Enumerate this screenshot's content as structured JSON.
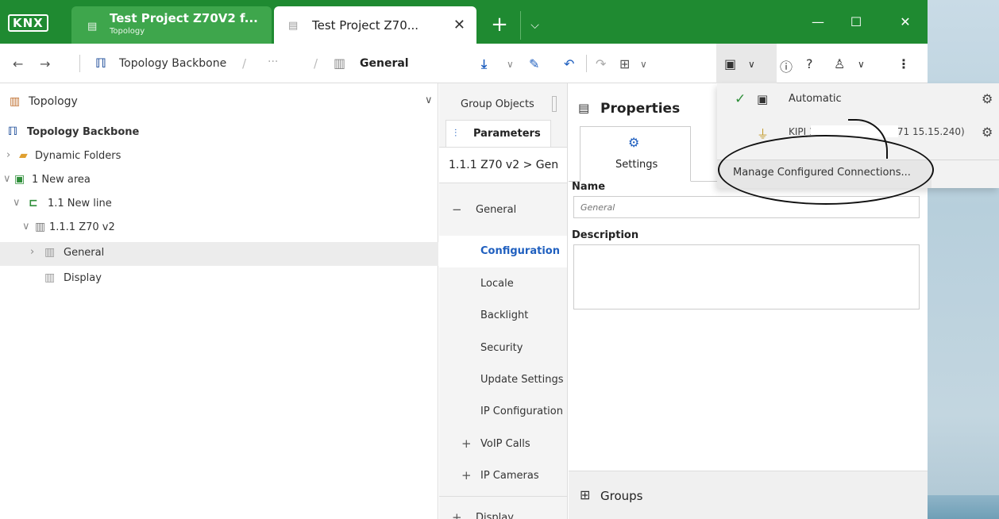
{
  "app": {
    "tabs": [
      {
        "title": "Test Project Z70V2 f...",
        "subtitle": "Topology"
      },
      {
        "title": "Test Project Z70..."
      }
    ],
    "logo_text": "KNX"
  },
  "toolbar": {
    "breadcrumb": {
      "root": "Topology Backbone",
      "ellipsis": "···",
      "current": "General"
    }
  },
  "left_panel": {
    "header": "Topology",
    "tree": [
      {
        "label": "Topology Backbone"
      },
      {
        "label": "Dynamic Folders"
      },
      {
        "label": "1 New area"
      },
      {
        "label": "1.1 New line"
      },
      {
        "label": "1.1.1 Z70 v2"
      },
      {
        "label": "General"
      },
      {
        "label": "Display"
      }
    ]
  },
  "mid_panel": {
    "tab_group_objects": "Group Objects",
    "tab_parameters": "Parameters",
    "breadcrumb": "1.1.1 Z70 v2 > Gen",
    "items": [
      {
        "label": "General",
        "prefix": "−"
      },
      {
        "label": "Configuration"
      },
      {
        "label": "Locale"
      },
      {
        "label": "Backlight"
      },
      {
        "label": "Security"
      },
      {
        "label": "Update Settings"
      },
      {
        "label": "IP Configuration"
      },
      {
        "label": "VoIP Calls",
        "prefix": "+"
      },
      {
        "label": "IP Cameras",
        "prefix": "+"
      },
      {
        "label": "Display",
        "prefix": "+"
      }
    ]
  },
  "properties": {
    "title": "Properties",
    "settings_tab": "Settings",
    "name_label": "Name",
    "name_placeholder": "General",
    "description_label": "Description",
    "groups_label": "Groups"
  },
  "connection_menu": {
    "automatic": "Automatic",
    "kipi": "KIPI 192.168.70.     :3671 15.15.240)",
    "manage": "Manage Configured Connections..."
  }
}
